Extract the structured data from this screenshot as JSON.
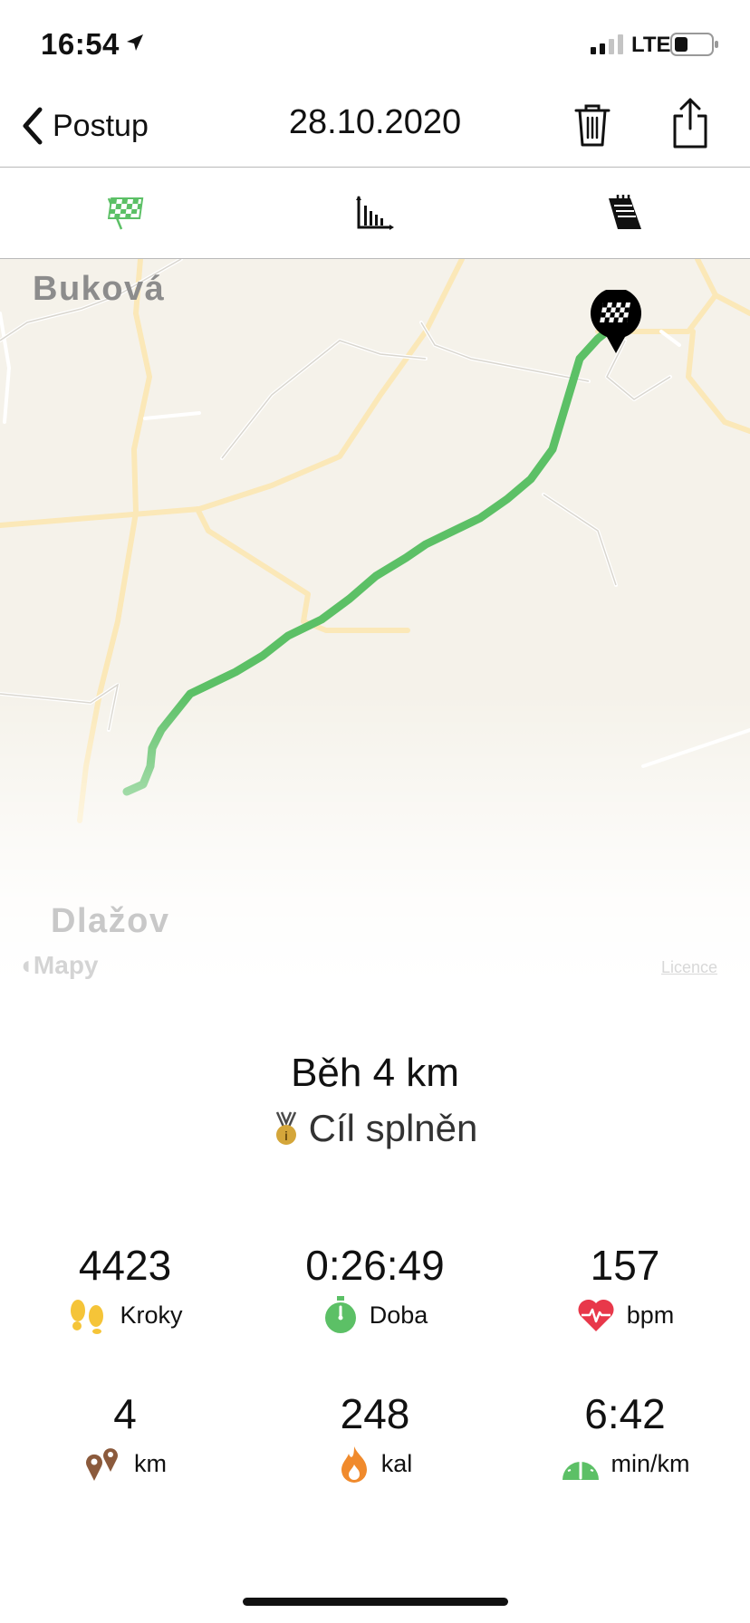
{
  "status_bar": {
    "time": "16:54",
    "network": "LTE",
    "icons": [
      "location-arrow-icon",
      "signal-icon",
      "battery-icon"
    ]
  },
  "nav": {
    "back_label": "Postup",
    "title": "28.10.2020",
    "icons": [
      "chevron-left-icon",
      "trash-icon",
      "share-icon"
    ]
  },
  "tabs": [
    {
      "icon": "checkered-flag-icon",
      "selected": true
    },
    {
      "icon": "bar-chart-icon",
      "selected": false
    },
    {
      "icon": "notes-icon",
      "selected": false
    }
  ],
  "map": {
    "places": [
      "Buková",
      "Dlažov"
    ],
    "attribution": "Mapy",
    "licence_link": "Licence",
    "route_color": "#5cc066"
  },
  "summary": {
    "activity": "Běh 4 km",
    "goal_status": "Cíl splněn"
  },
  "stats": [
    {
      "value": "4423",
      "label": "Kroky",
      "icon": "footprints-icon"
    },
    {
      "value": "0:26:49",
      "label": "Doba",
      "icon": "stopwatch-icon"
    },
    {
      "value": "157",
      "label": "bpm",
      "icon": "heart-rate-icon"
    },
    {
      "value": "4",
      "label": "km",
      "icon": "distance-pins-icon"
    },
    {
      "value": "248",
      "label": "kal",
      "icon": "flame-icon"
    },
    {
      "value": "6:42",
      "label": "min/km",
      "icon": "speedometer-icon"
    }
  ],
  "colors": {
    "accent_green": "#5cc066",
    "heart_red": "#e8384a",
    "flame_orange": "#f08a2c",
    "medal_gold": "#d4a63a",
    "footprint_yellow": "#f5c438",
    "pin_brown": "#8b5a3c"
  }
}
